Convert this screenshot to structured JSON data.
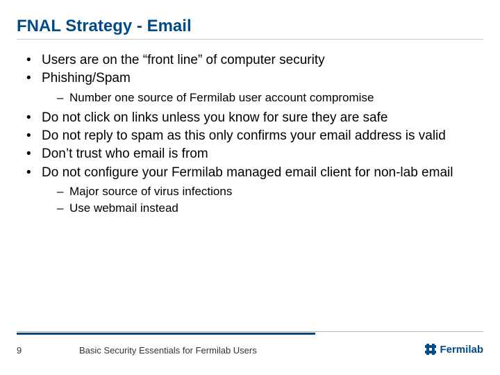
{
  "title": "FNAL Strategy - Email",
  "bullets": {
    "b1": "Users are on the “front line” of computer security",
    "b2": "Phishing/Spam",
    "b2_sub": {
      "s1": "Number one source of Fermilab user account compromise"
    },
    "b3": "Do not click on links unless you know for sure they are safe",
    "b4": "Do not reply to spam as this only confirms your email address is valid",
    "b5": "Don’t trust who email is from",
    "b6": "Do not configure your Fermilab managed email client for non-lab email",
    "b6_sub": {
      "s1": "Major source of virus infections",
      "s2": "Use webmail instead"
    }
  },
  "footer": {
    "page": "9",
    "title": "Basic Security Essentials for Fermilab Users",
    "logo_text": "Fermilab"
  },
  "colors": {
    "brand": "#004b87"
  }
}
